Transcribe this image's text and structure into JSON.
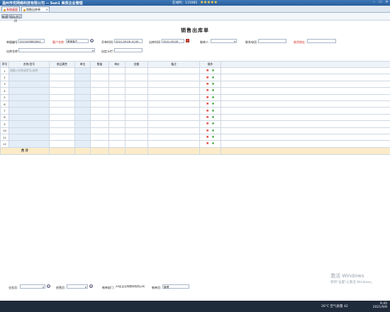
{
  "window": {
    "title": "温州市优网络科技有限公司 -- Sun1 商贸企业管理",
    "user_info": "在线时：115085",
    "stars": "★★★★★",
    "min_icon": "–",
    "restore_icon": "▭",
    "close_icon": "✕"
  },
  "tabs": [
    {
      "label": "系统桌面",
      "close": ""
    },
    {
      "label": "销售出库单",
      "close": "✕"
    }
  ],
  "toolbar": {
    "new_label": "新建",
    "save_label": "保存并打印"
  },
  "form": {
    "title": "销售出库单",
    "doc_no_label": "单据编号：",
    "doc_no_value": "2021090800001",
    "customer_label": "客户名称：",
    "customer_value": "散客客户",
    "created_label": "开单时间：",
    "created_value": "2021-09-08 10:39",
    "out_time_label": "出库时间：",
    "out_time_value": "2021-09-08",
    "handler_label": "制单人：",
    "contact_label": "联系电话：",
    "address_label": "收货地址：",
    "warehouse_label": "出库仓库：",
    "custom_label": "自定义栏："
  },
  "table": {
    "headers": [
      "序号",
      "名称/型号",
      "商品属性",
      "单位",
      "数量",
      "单价",
      "金额",
      "备注",
      "操作"
    ],
    "placeholder": "请输入名称或型号/选择",
    "rows": [
      "1",
      "2",
      "3",
      "4",
      "5",
      "6",
      "7",
      "8",
      "9",
      "10",
      "11",
      "12"
    ],
    "delete_glyph": "✖",
    "add_glyph": "✚",
    "total_label": "合 计"
  },
  "footer": {
    "salesman_label": "业务员：",
    "courier_label": "经营员：",
    "dept_label": "制单部门：",
    "dept_value": "XX区企业有限司机构公司",
    "maker_label": "制单员：",
    "maker_value": "管理"
  },
  "activation": {
    "line1": "激活 Windows",
    "line2": "转到\"设置\"以激活 Windows。"
  },
  "taskbar": {
    "weather": "26°C 空气质量 42",
    "time": "9:40",
    "date": "2021/9/8"
  }
}
